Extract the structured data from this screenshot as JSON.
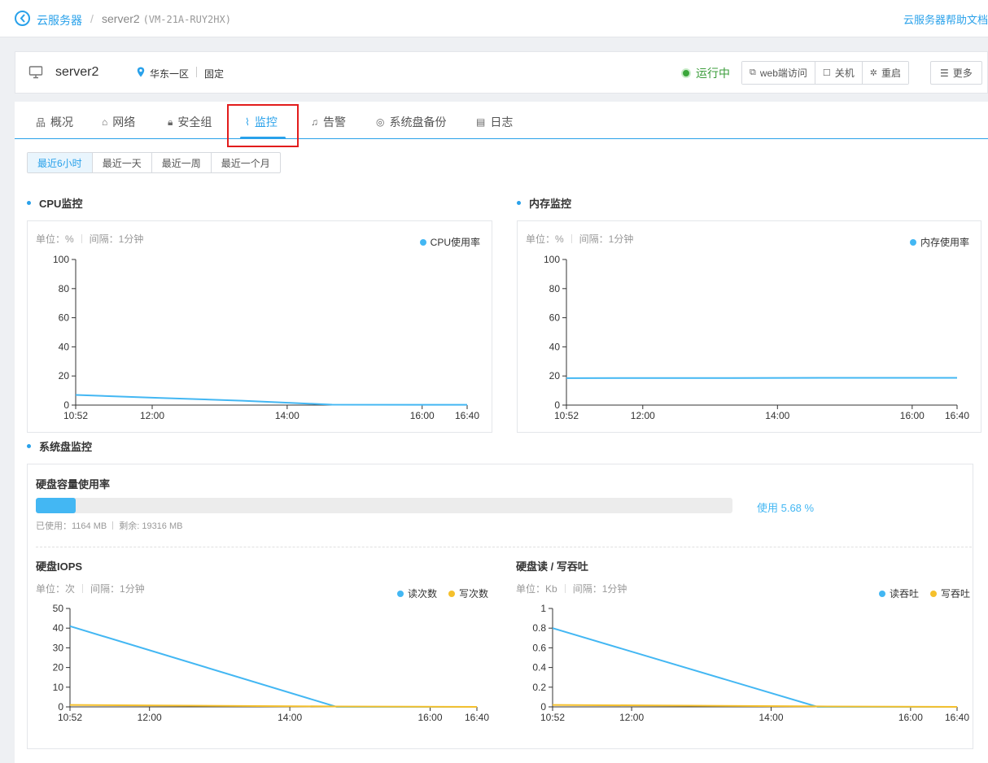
{
  "topbar": {
    "crumb_parent": "云服务器",
    "crumb_sep": "/",
    "crumb_name": "server2",
    "crumb_code": "(VM-21A-RUY2HX)",
    "help_link": "云服务器帮助文档"
  },
  "server": {
    "name": "server2",
    "region": "华东一区",
    "billing": "固定",
    "status": "运行中",
    "status_color": "#3a9c3a",
    "buttons": {
      "web_console": "web端访问",
      "shutdown": "关机",
      "reboot": "重启",
      "more": "更多"
    }
  },
  "tabs": [
    "概况",
    "网络",
    "安全组",
    "监控",
    "告警",
    "系统盘备份",
    "日志"
  ],
  "active_tab": "监控",
  "ranges": [
    "最近6小时",
    "最近一天",
    "最近一周",
    "最近一个月"
  ],
  "active_range": "最近6小时",
  "accent": "#29a1ea",
  "cpu": {
    "title": "CPU监控",
    "unit_label": "单位：%",
    "interval_label": "间隔：1分钟"
  },
  "memory": {
    "title": "内存监控",
    "unit_label": "单位：%",
    "interval_label": "间隔：1分钟"
  },
  "disk": {
    "title": "系统盘监控",
    "capacity_title": "硬盘容量使用率",
    "usage_label": "使用 5.68 %",
    "usage_fraction": 0.0568,
    "used_label": "已使用：1164 MB",
    "free_label": "剩余: 19316 MB",
    "iops_title": "硬盘IOPS",
    "iops_unit": "单位：次",
    "iops_interval": "间隔：1分钟",
    "tp_title": "硬盘读 / 写吞吐",
    "tp_unit": "单位：Kb",
    "tp_interval": "间隔：1分钟"
  },
  "chart_data": [
    {
      "id": "cpu",
      "type": "line",
      "x_ticks": [
        "10:52",
        "12:00",
        "14:00",
        "16:00",
        "16:40"
      ],
      "x_minutes": [
        652,
        720,
        840,
        960,
        1000
      ],
      "ylim": [
        0,
        100
      ],
      "y_ticks": [
        0,
        20,
        40,
        60,
        80,
        100
      ],
      "series": [
        {
          "name": "CPU使用率",
          "color": "#43b7f3",
          "x": [
            652,
            725,
            800,
            880,
            960,
            1000
          ],
          "y": [
            7,
            5,
            3,
            0.3,
            0.2,
            0.2
          ]
        }
      ]
    },
    {
      "id": "memory",
      "type": "line",
      "x_ticks": [
        "10:52",
        "12:00",
        "14:00",
        "16:00",
        "16:40"
      ],
      "x_minutes": [
        652,
        720,
        840,
        960,
        1000
      ],
      "ylim": [
        0,
        100
      ],
      "y_ticks": [
        0,
        20,
        40,
        60,
        80,
        100
      ],
      "series": [
        {
          "name": "内存使用率",
          "color": "#43b7f3",
          "x": [
            652,
            720,
            800,
            880,
            960,
            1000
          ],
          "y": [
            18.5,
            18.6,
            18.6,
            18.7,
            18.7,
            18.7
          ]
        }
      ]
    },
    {
      "id": "iops",
      "type": "line",
      "x_ticks": [
        "10:52",
        "12:00",
        "14:00",
        "16:00",
        "16:40"
      ],
      "x_minutes": [
        652,
        720,
        840,
        960,
        1000
      ],
      "ylim": [
        0,
        50
      ],
      "y_ticks": [
        0,
        10,
        20,
        30,
        40,
        50
      ],
      "series": [
        {
          "name": "读次数",
          "color": "#43b7f3",
          "x": [
            652,
            880,
            1000
          ],
          "y": [
            41,
            0,
            0
          ]
        },
        {
          "name": "写次数",
          "color": "#f5c02c",
          "x": [
            652,
            880,
            1000
          ],
          "y": [
            1,
            0.2,
            0
          ]
        }
      ]
    },
    {
      "id": "throughput",
      "type": "line",
      "x_ticks": [
        "10:52",
        "12:00",
        "14:00",
        "16:00",
        "16:40"
      ],
      "x_minutes": [
        652,
        720,
        840,
        960,
        1000
      ],
      "ylim": [
        0,
        1
      ],
      "y_ticks": [
        0,
        0.2,
        0.4,
        0.6,
        0.8,
        1
      ],
      "series": [
        {
          "name": "读吞吐",
          "color": "#43b7f3",
          "x": [
            652,
            880,
            1000
          ],
          "y": [
            0.8,
            0,
            0
          ]
        },
        {
          "name": "写吞吐",
          "color": "#f5c02c",
          "x": [
            652,
            880,
            1000
          ],
          "y": [
            0.02,
            0.005,
            0
          ]
        }
      ]
    }
  ]
}
